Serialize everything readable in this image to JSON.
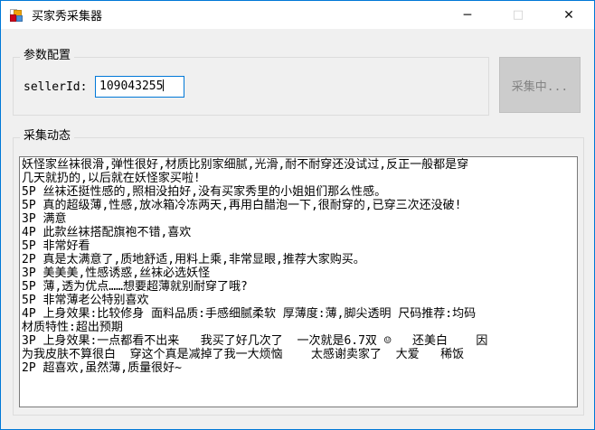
{
  "window": {
    "title": "买家秀采集器",
    "controls": {
      "minimize": "─",
      "maximize": "□",
      "close": "✕"
    }
  },
  "colors": {
    "accent_border": "#0078d7",
    "titlebar_bg": "#ffffff",
    "client_bg": "#f0f0f0",
    "groupbox_border": "#dcdcdc",
    "textbox_border": "#7a7a7a",
    "focused_input_border": "#0078d7",
    "disabled_button_bg": "#cccccc",
    "disabled_button_text": "#838383"
  },
  "param_group": {
    "title": "参数配置",
    "seller_id_label": "sellerId:",
    "seller_id_value": "109043255"
  },
  "collect_button": {
    "label": "采集中...",
    "state": "disabled"
  },
  "log_group": {
    "title": "采集动态",
    "lines": [
      "妖怪家丝袜很滑,弹性很好,材质比别家细腻,光滑,耐不耐穿还没试过,反正一般都是穿",
      "几天就扔的,以后就在妖怪家买啦!",
      "5P 丝袜还挺性感的,照相没拍好,没有买家秀里的小姐姐们那么性感。",
      "5P 真的超级薄,性感,放冰箱冷冻两天,再用白醋泡一下,很耐穿的,已穿三次还没破!",
      "3P 满意",
      "4P 此款丝袜搭配旗袍不错,喜欢",
      "5P 非常好看",
      "2P 真是太满意了,质地舒适,用料上乘,非常显眼,推荐大家购买。",
      "3P 美美美,性感诱惑,丝袜必选妖怪",
      "5P 薄,透为优点……想要超薄就别耐穿了哦?",
      "5P 非常薄老公特别喜欢",
      "4P 上身效果:比较修身 面料品质:手感细腻柔软 厚薄度:薄,脚尖透明 尺码推荐:均码",
      "材质特性:超出预期",
      "3P 上身效果:一点都看不出来   我买了好几次了  一次就是6.7双 ☺   还美白    因",
      "为我皮肤不算很白  穿这个真是减掉了我一大烦恼    太感谢卖家了  大爱   稀饭",
      "2P 超喜欢,虽然薄,质量很好~"
    ]
  }
}
